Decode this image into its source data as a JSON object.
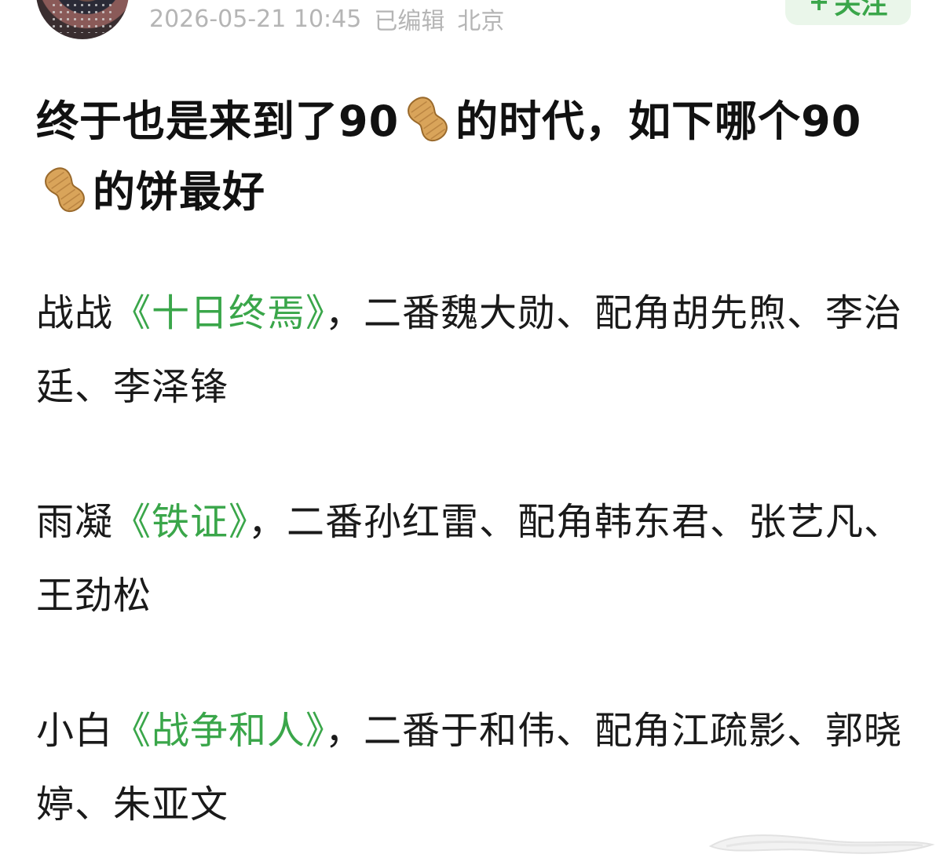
{
  "post": {
    "timestamp": "2026-05-21 10:45",
    "edited": "已编辑",
    "location": "北京",
    "follow": {
      "icon": "plus-icon",
      "label": "关注"
    },
    "title": {
      "part1": "终于也是来到了90",
      "part2": "的时代，如下哪个90",
      "part3": "的饼最好",
      "emoji": "peanut-emoji"
    },
    "paragraphs": [
      {
        "lead": "战战",
        "book": "《十日终焉》",
        "rest": "，二番魏大勋、配角胡先煦、李治廷、李泽锋"
      },
      {
        "lead": "雨凝",
        "book": "《铁证》",
        "rest": "，二番孙红雷、配角韩东君、张艺凡、王劲松"
      },
      {
        "lead": "小白",
        "book": "《战争和人》",
        "rest": "，二番于和伟、配角江疏影、郭晓婷、朱亚文"
      }
    ]
  },
  "colors": {
    "accent_green": "#3aa64a",
    "follow_bg": "#eaf6ea",
    "meta_gray": "#b5b5b5",
    "text": "#111111"
  }
}
